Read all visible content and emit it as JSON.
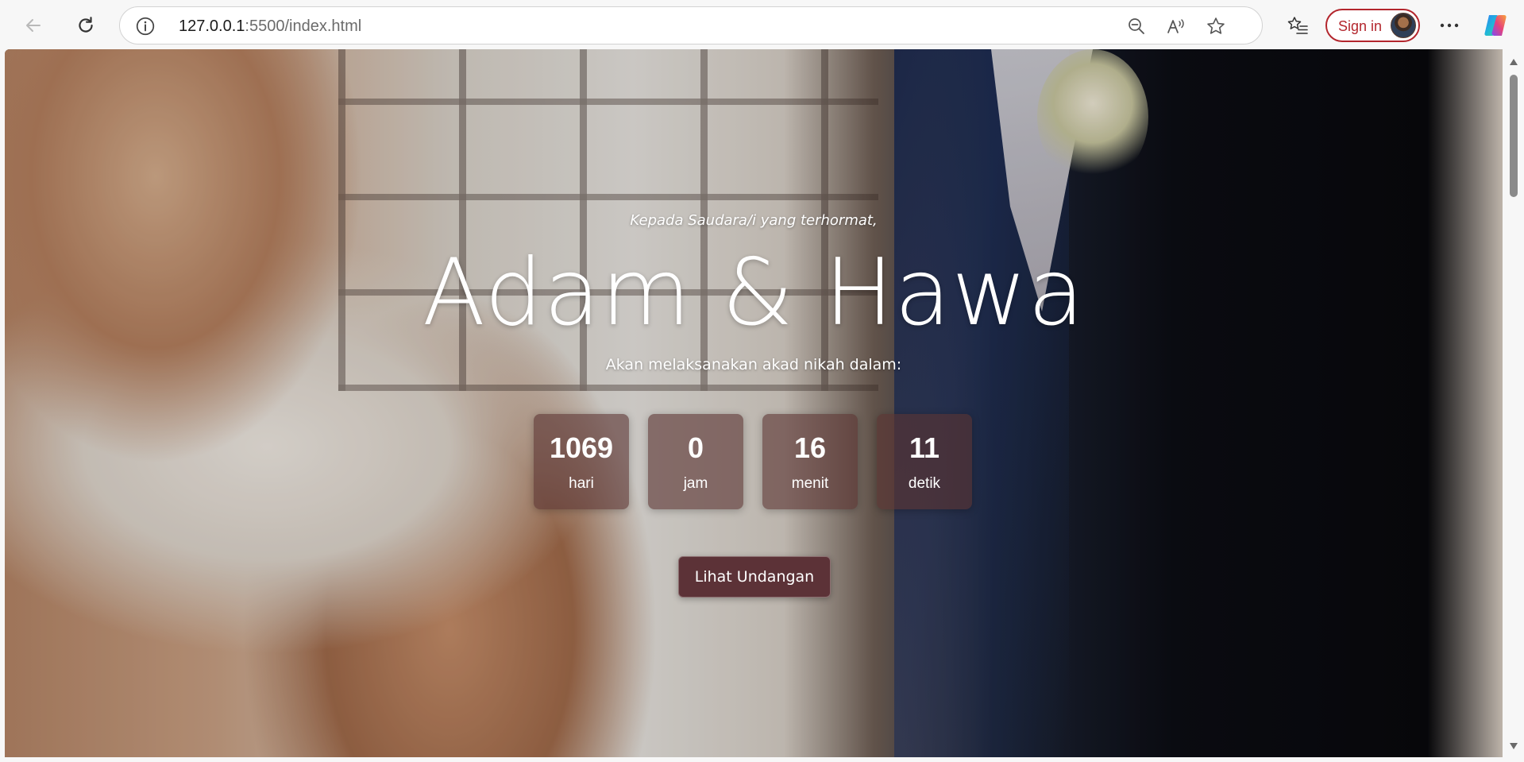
{
  "browser": {
    "url_host": "127.0.0.1",
    "url_rest": ":5500/index.html",
    "sign_in_label": "Sign in",
    "icons": {
      "back": "back-arrow-icon",
      "reload": "reload-icon",
      "site_info": "info-icon",
      "zoom_out": "zoom-out-icon",
      "read_aloud": "read-aloud-icon",
      "favorite": "star-icon",
      "favorites_list": "favorites-icon",
      "more": "more-icon",
      "copilot": "copilot-icon"
    }
  },
  "hero": {
    "greeting": "Kepada Saudara/i yang terhormat,",
    "couple_names": "Adam & Hawa",
    "announcement": "Akan melaksanakan akad nikah dalam:",
    "countdown": [
      {
        "value": "1069",
        "unit": "hari"
      },
      {
        "value": "0",
        "unit": "jam"
      },
      {
        "value": "16",
        "unit": "menit"
      },
      {
        "value": "11",
        "unit": "detik"
      }
    ],
    "cta_label": "Lihat Undangan"
  },
  "colors": {
    "accent_button": "#5c3237",
    "countdown_box": "#5a3432",
    "sign_in_border": "#b3262d"
  }
}
